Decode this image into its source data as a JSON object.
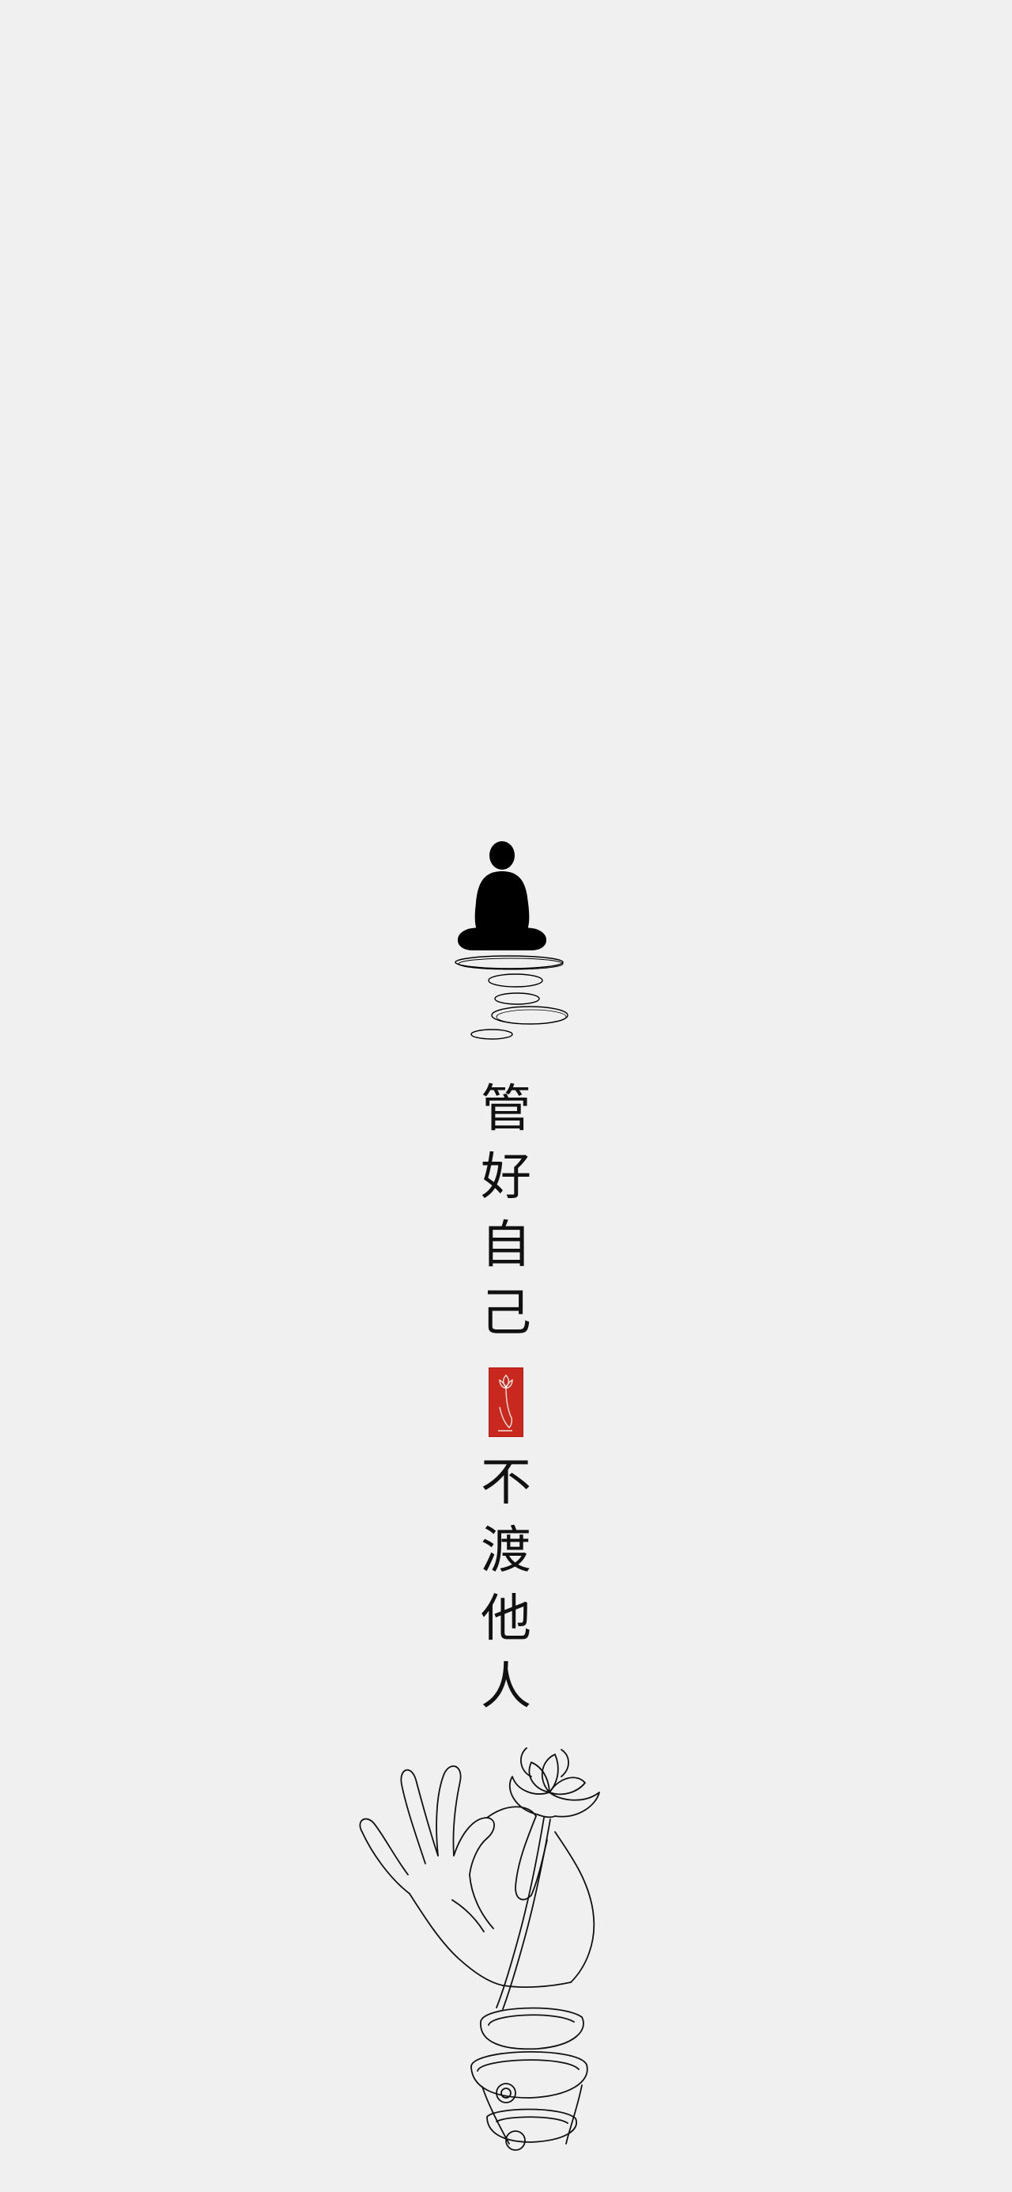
{
  "quote": {
    "first_line": [
      "管",
      "好",
      "自",
      "己"
    ],
    "second_line": [
      "不",
      "渡",
      "他",
      "人"
    ]
  },
  "icons": {
    "top": "meditating-figure-icon",
    "seal": "lotus-seal-icon",
    "bottom": "hand-holding-lotus-icon"
  },
  "colors": {
    "background": "#f0f0f0",
    "ink": "#111111",
    "seal": "#c8281e"
  }
}
